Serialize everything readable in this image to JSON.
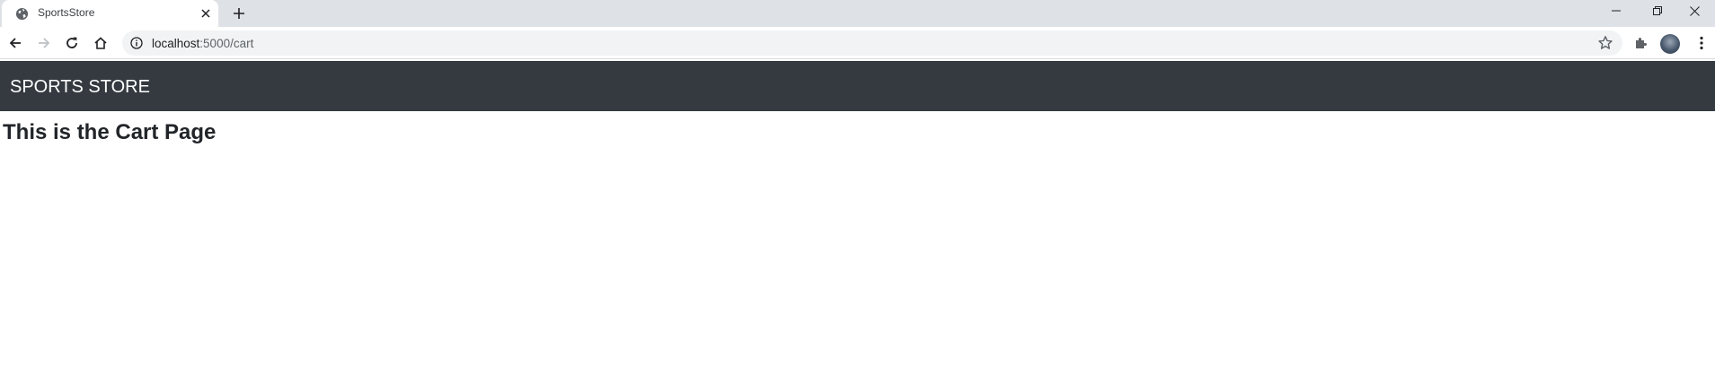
{
  "browser": {
    "tab": {
      "title": "SportsStore",
      "favicon": "globe-icon"
    },
    "new_tab_icon": "plus-icon",
    "window_controls": [
      "minimize-icon",
      "restore-icon",
      "close-icon"
    ],
    "address_bar": {
      "host": "localhost",
      "path": ":5000/cart",
      "security_icon": "info-icon"
    },
    "toolbar_icons": [
      "back-arrow-icon",
      "forward-arrow-icon",
      "reload-icon",
      "home-icon",
      "star-icon",
      "puzzle-icon",
      "avatar",
      "kebab-menu-icon"
    ]
  },
  "page": {
    "navbar": {
      "brand": "SPORTS STORE",
      "background": "#343a40"
    },
    "heading": "This is the Cart Page"
  }
}
